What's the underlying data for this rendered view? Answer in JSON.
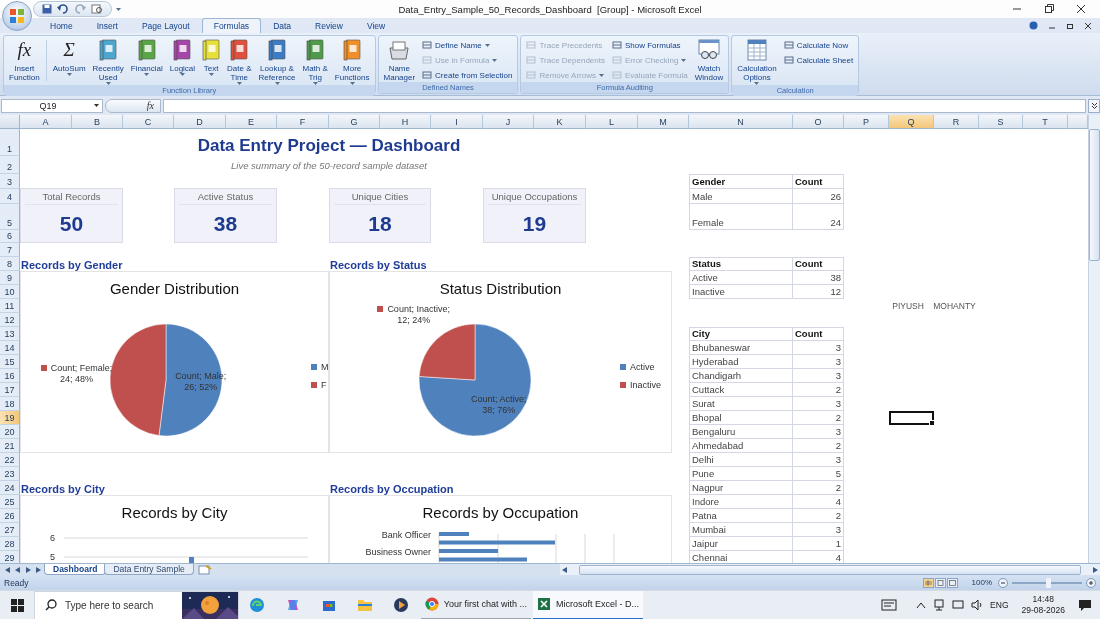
{
  "window": {
    "title": "Data_Entry_Sample_50_Records_Dashboard  [Group] - Microsoft Excel"
  },
  "ribbon_tabs": [
    {
      "label": "Home",
      "selected": false
    },
    {
      "label": "Insert",
      "selected": false
    },
    {
      "label": "Page Layout",
      "selected": false
    },
    {
      "label": "Formulas",
      "selected": true
    },
    {
      "label": "Data",
      "selected": false
    },
    {
      "label": "Review",
      "selected": false
    },
    {
      "label": "View",
      "selected": false
    }
  ],
  "ribbon_groups": [
    {
      "label": "Function Library",
      "items": [
        {
          "kind": "large",
          "glyph": "fx",
          "lines": [
            "Insert",
            "Function"
          ],
          "dropdown": false
        },
        {
          "kind": "large",
          "glyph": "Σ",
          "lines": [
            "AutoSum"
          ],
          "dropdown": true
        },
        {
          "kind": "large",
          "color": "#4ea6cf",
          "lines": [
            "Recently",
            "Used"
          ],
          "dropdown": true
        },
        {
          "kind": "large",
          "color": "#5aa547",
          "lines": [
            "Financial"
          ],
          "dropdown": true
        },
        {
          "kind": "large",
          "color": "#a447a8",
          "lines": [
            "Logical"
          ],
          "dropdown": true
        },
        {
          "kind": "large",
          "color": "#e6df3c",
          "lines": [
            "Text"
          ],
          "dropdown": true
        },
        {
          "kind": "large",
          "color": "#e0503e",
          "lines": [
            "Date &",
            "Time"
          ],
          "dropdown": true
        },
        {
          "kind": "large",
          "color": "#3d7cc4",
          "lines": [
            "Lookup &",
            "Reference"
          ],
          "dropdown": true
        },
        {
          "kind": "large",
          "color": "#4f9a4c",
          "lines": [
            "Math &",
            "Trig"
          ],
          "dropdown": true
        },
        {
          "kind": "large",
          "color": "#f0902c",
          "lines": [
            "More",
            "Functions"
          ],
          "dropdown": true
        }
      ]
    },
    {
      "label": "Defined Names",
      "items": [
        {
          "kind": "large",
          "lines": [
            "Name",
            "Manager"
          ],
          "dropdown": false
        },
        {
          "kind": "small",
          "label": "Define Name",
          "dropdown": true,
          "disabled": false
        },
        {
          "kind": "small",
          "label": "Use in Formula",
          "dropdown": true,
          "disabled": true
        },
        {
          "kind": "small",
          "label": "Create from Selection",
          "dropdown": false,
          "disabled": false
        }
      ]
    },
    {
      "label": "Formula Auditing",
      "items": [
        {
          "kind": "small",
          "label": "Trace Precedents",
          "dropdown": false,
          "disabled": true
        },
        {
          "kind": "small",
          "label": "Trace Dependents",
          "dropdown": false,
          "disabled": true
        },
        {
          "kind": "small",
          "label": "Remove Arrows",
          "dropdown": true,
          "disabled": true
        },
        {
          "kind": "small",
          "label": "Show Formulas",
          "dropdown": false,
          "disabled": false
        },
        {
          "kind": "small",
          "label": "Error Checking",
          "dropdown": true,
          "disabled": true
        },
        {
          "kind": "small",
          "label": "Evaluate Formula",
          "dropdown": false,
          "disabled": true
        },
        {
          "kind": "large",
          "lines": [
            "Watch",
            "Window"
          ],
          "dropdown": false
        }
      ]
    },
    {
      "label": "Calculation",
      "items": [
        {
          "kind": "large",
          "lines": [
            "Calculation",
            "Options"
          ],
          "dropdown": true
        },
        {
          "kind": "small",
          "label": "Calculate Now",
          "dropdown": false,
          "disabled": false
        },
        {
          "kind": "small",
          "label": "Calculate Sheet",
          "dropdown": false,
          "disabled": false
        }
      ]
    }
  ],
  "formula_bar": {
    "name_box": "Q19",
    "fx": "fx"
  },
  "columns": [
    {
      "label": "A",
      "selected": false
    },
    {
      "label": "B",
      "selected": false
    },
    {
      "label": "C",
      "selected": false
    },
    {
      "label": "D",
      "selected": false
    },
    {
      "label": "E",
      "selected": false
    },
    {
      "label": "F",
      "selected": false
    },
    {
      "label": "G",
      "selected": false
    },
    {
      "label": "H",
      "selected": false
    },
    {
      "label": "I",
      "selected": false
    },
    {
      "label": "J",
      "selected": false
    },
    {
      "label": "K",
      "selected": false
    },
    {
      "label": "L",
      "selected": false
    },
    {
      "label": "M",
      "selected": false
    },
    {
      "label": "N",
      "selected": false
    },
    {
      "label": "O",
      "selected": false
    },
    {
      "label": "P",
      "selected": false
    },
    {
      "label": "Q",
      "selected": true
    },
    {
      "label": "R",
      "selected": false
    },
    {
      "label": "S",
      "selected": false
    },
    {
      "label": "T",
      "selected": false
    }
  ],
  "rows": [
    {
      "label": "1",
      "selected": false
    },
    {
      "label": "2",
      "selected": false
    },
    {
      "label": "3",
      "selected": false
    },
    {
      "label": "4",
      "selected": false
    },
    {
      "label": "5",
      "selected": false
    },
    {
      "label": "6",
      "selected": false
    },
    {
      "label": "7",
      "selected": false
    },
    {
      "label": "8",
      "selected": false
    },
    {
      "label": "9",
      "selected": false
    },
    {
      "label": "10",
      "selected": false
    },
    {
      "label": "11",
      "selected": false
    },
    {
      "label": "12",
      "selected": false
    },
    {
      "label": "13",
      "selected": false
    },
    {
      "label": "14",
      "selected": false
    },
    {
      "label": "15",
      "selected": false
    },
    {
      "label": "16",
      "selected": false
    },
    {
      "label": "17",
      "selected": false
    },
    {
      "label": "18",
      "selected": false
    },
    {
      "label": "19",
      "selected": true
    },
    {
      "label": "20",
      "selected": false
    },
    {
      "label": "21",
      "selected": false
    },
    {
      "label": "22",
      "selected": false
    },
    {
      "label": "23",
      "selected": false
    },
    {
      "label": "24",
      "selected": false
    },
    {
      "label": "25",
      "selected": false
    },
    {
      "label": "26",
      "selected": false
    },
    {
      "label": "27",
      "selected": false
    },
    {
      "label": "28",
      "selected": false
    },
    {
      "label": "29",
      "selected": false
    }
  ],
  "dashboard": {
    "title": "Data Entry Project — Dashboard",
    "subtitle": "Live summary of the 50-record sample dataset",
    "cards": [
      {
        "label": "Total Records",
        "value": "50"
      },
      {
        "label": "Active Status",
        "value": "38"
      },
      {
        "label": "Unique Cities",
        "value": "18"
      },
      {
        "label": "Unique Occupations",
        "value": "19"
      }
    ],
    "charts": [
      {
        "kind": "pie",
        "section_label": "Records by Gender",
        "chart_data": {
          "type": "pie",
          "title": "Gender Distribution",
          "values": [
            26,
            24
          ],
          "data_labels": true,
          "value_labels": [
            "26; 52%",
            "24; 48%"
          ]
        },
        "label_heads": [
          "Count; Male;",
          "Count; Female;"
        ],
        "slices": [
          {
            "color": "#4f81bd"
          },
          {
            "color": "#c0504d"
          }
        ],
        "legend_entries": [
          "M",
          "F"
        ]
      },
      {
        "kind": "pie",
        "section_label": "Records by Status",
        "chart_data": {
          "type": "pie",
          "title": "Status Distribution",
          "values": [
            38,
            12
          ],
          "data_labels": true,
          "value_labels": [
            "38; 76%",
            "12; 24%"
          ]
        },
        "label_heads": [
          "Count; Active;",
          "Count; Inactive;"
        ],
        "slices": [
          {
            "color": "#4f81bd"
          },
          {
            "color": "#c0504d"
          }
        ],
        "legend_entries": [
          "Active",
          "Inactive"
        ]
      },
      {
        "kind": "column",
        "section_label": "Records by City",
        "title": "Records by City",
        "y_tick_labels": [
          "6",
          "5"
        ]
      },
      {
        "kind": "hbar",
        "section_label": "Records by Occupation",
        "title": "Records by Occupation",
        "category_labels": [
          "Bank Officer",
          "Business Owner"
        ]
      }
    ],
    "tables": [
      {
        "header": [
          "Gender",
          "Count"
        ],
        "rows": [
          [
            "Male",
            "26"
          ],
          [
            "Female",
            "24"
          ]
        ]
      },
      {
        "header": [
          "Status",
          "Count"
        ],
        "rows": [
          [
            "Active",
            "38"
          ],
          [
            "Inactive",
            "12"
          ]
        ]
      },
      {
        "header": [
          "City",
          "Count"
        ],
        "rows": [
          [
            "Bhubaneswar",
            "3"
          ],
          [
            "Hyderabad",
            "3"
          ],
          [
            "Chandigarh",
            "3"
          ],
          [
            "Cuttack",
            "2"
          ],
          [
            "Surat",
            "3"
          ],
          [
            "Bhopal",
            "2"
          ],
          [
            "Bengaluru",
            "3"
          ],
          [
            "Ahmedabad",
            "2"
          ],
          [
            "Delhi",
            "3"
          ],
          [
            "Pune",
            "5"
          ],
          [
            "Nagpur",
            "2"
          ],
          [
            "Indore",
            "4"
          ],
          [
            "Patna",
            "2"
          ],
          [
            "Mumbai",
            "3"
          ],
          [
            "Jaipur",
            "1"
          ],
          [
            "Chennai",
            "4"
          ]
        ]
      }
    ],
    "author": "PIYUSH MOHANTY"
  },
  "sheet_tabs": [
    {
      "label": "Dashboard",
      "selected": true
    },
    {
      "label": "Data Entry Sample",
      "selected": false
    }
  ],
  "status_bar": {
    "text": "Ready",
    "zoom": "100%",
    "zoom_slider": {
      "level": 0.52
    }
  },
  "taskbar": {
    "search_placeholder": "Type here to search",
    "apps": [
      {
        "label": "Your first chat with ...",
        "selected": false
      },
      {
        "label": "Microsoft Excel - D...",
        "selected": true
      }
    ],
    "language": "ENG",
    "time": "14:48",
    "date": "29-08-2026"
  }
}
